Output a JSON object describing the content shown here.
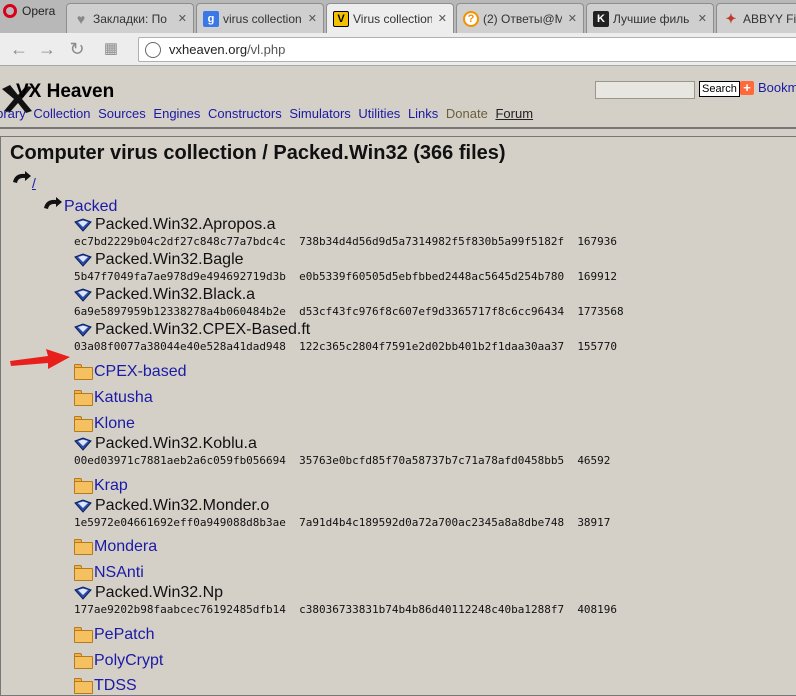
{
  "browser": {
    "opera_label": "Opera",
    "tabs": [
      {
        "title": "Закладки: По",
        "icon": "heart-icon",
        "active": false
      },
      {
        "title": "virus collection",
        "icon": "google-icon",
        "active": false
      },
      {
        "title": "Virus collection",
        "icon": "vx-icon",
        "active": true
      },
      {
        "title": "(2) Ответы@M",
        "icon": "question-icon",
        "active": false
      },
      {
        "title": "Лучшие филь",
        "icon": "k-icon",
        "active": false
      },
      {
        "title": "ABBYY Fine",
        "icon": "abbyy-icon",
        "active": false
      }
    ],
    "url_host": "vxheaven.org",
    "url_path": "/vl.php"
  },
  "site": {
    "title": "VX Heaven",
    "nav": [
      "Library",
      "Collection",
      "Sources",
      "Engines",
      "Constructors",
      "Simulators",
      "Utilities",
      "Links",
      "Donate",
      "Forum"
    ],
    "search_button": "Search",
    "bookmark_label": "Bookm",
    "bookmark_plus": "+"
  },
  "content": {
    "page_title": "Computer virus collection / Packed.Win32 (366 files)",
    "updir_label": "/",
    "parent_folder": "Packed",
    "entries": [
      {
        "kind": "file",
        "name": "Packed.Win32.Apropos.a",
        "hash": "ec7bd2229b04c2df27c848c77a7bdc4c  738b34d4d56d9d5a7314982f5f830b5a99f5182f  167936"
      },
      {
        "kind": "file",
        "name": "Packed.Win32.Bagle",
        "hash": "5b47f7049fa7ae978d9e494692719d3b  e0b5339f60505d5ebfbbed2448ac5645d254b780  169912"
      },
      {
        "kind": "file",
        "name": "Packed.Win32.Black.a",
        "hash": "6a9e5897959b12338278a4b060484b2e  d53cf43fc976f8c607ef9d3365717f8c6cc96434  1773568",
        "highlight": true
      },
      {
        "kind": "file",
        "name": "Packed.Win32.CPEX-Based.ft",
        "hash": "03a08f0077a38044e40e528a41dad948  122c365c2804f7591e2d02bb401b2f1daa30aa37  155770"
      },
      {
        "kind": "folder",
        "name": "CPEX-based"
      },
      {
        "kind": "folder",
        "name": "Katusha"
      },
      {
        "kind": "folder",
        "name": "Klone"
      },
      {
        "kind": "file",
        "name": "Packed.Win32.Koblu.a",
        "hash": "00ed03971c7881aeb2a6c059fb056694  35763e0bcfd85f70a58737b7c71a78afd0458bb5  46592"
      },
      {
        "kind": "folder",
        "name": "Krap"
      },
      {
        "kind": "file",
        "name": "Packed.Win32.Monder.o",
        "hash": "1e5972e04661692eff0a949088d8b3ae  7a91d4b4c189592d0a72a700ac2345a8a8dbe748  38917"
      },
      {
        "kind": "folder",
        "name": "Mondera"
      },
      {
        "kind": "folder",
        "name": "NSAnti"
      },
      {
        "kind": "file",
        "name": "Packed.Win32.Np",
        "hash": "177ae9202b98faabcec76192485dfb14  c38036733831b74b4b86d40112248c40ba1288f7  408196"
      },
      {
        "kind": "folder",
        "name": "PePatch"
      },
      {
        "kind": "folder",
        "name": "PolyCrypt"
      },
      {
        "kind": "folder",
        "name": "TDSS"
      }
    ]
  },
  "colors": {
    "link": "#1a1aa6",
    "arrow": "#e8201c",
    "page_bg": "#d4d0c8"
  }
}
